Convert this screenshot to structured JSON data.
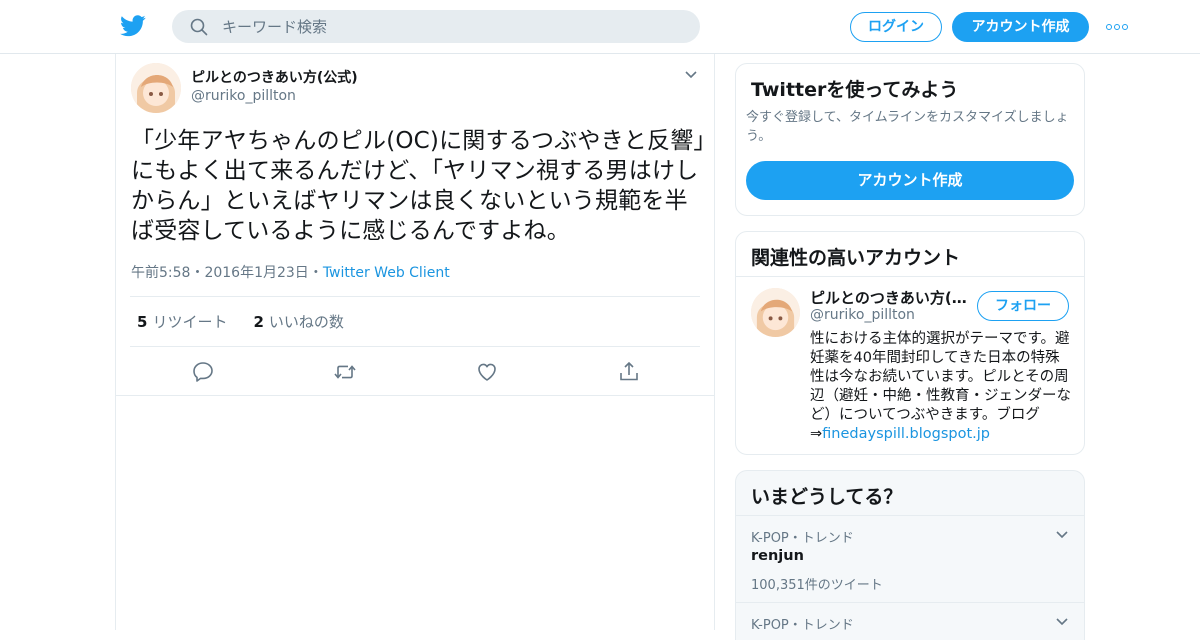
{
  "header": {
    "search_placeholder": "キーワード検索",
    "login_label": "ログイン",
    "signup_label": "アカウント作成",
    "brand_color": "#1da1f2"
  },
  "tweet": {
    "display_name": "ピルとのつきあい方(公式)",
    "handle": "@ruriko_pillton",
    "text": "「少年アヤちゃんのピル(OC)に関するつぶやきと反響」にもよく出て来るんだけど、「ヤリマン視する男はけしからん」といえばヤリマンは良くないという規範を半ば受容しているように感じるんですよね。",
    "time": "午前5:58",
    "date": "2016年1月23日",
    "source": "Twitter Web Client",
    "separator": "・",
    "retweet_count": "5",
    "retweet_label": "リツイート",
    "like_count": "2",
    "like_label": "いいねの数"
  },
  "signup_card": {
    "title": "Twitterを使ってみよう",
    "description": "今すぐ登録して、タイムラインをカスタマイズしましょう。",
    "button_label": "アカウント作成"
  },
  "related_card": {
    "title": "関連性の高いアカウント",
    "account": {
      "display_name": "ピルとのつきあい方(公式)",
      "handle": "@ruriko_pillton",
      "follow_label": "フォロー",
      "bio": "性における主体的選択がテーマです。避妊薬を40年間封印してきた日本の特殊性は今なお続いています。ピルとその周辺（避妊・中絶・性教育・ジェンダーなど）についてつぶやきます。ブログ⇒",
      "bio_link": "finedayspill.blogspot.jp"
    }
  },
  "trends_card": {
    "title": "いまどうしてる？",
    "trends": [
      {
        "context": "K-POP・トレンド",
        "name": "renjun",
        "count": "100,351件のツイート"
      },
      {
        "context": "K-POP・トレンド"
      }
    ]
  }
}
